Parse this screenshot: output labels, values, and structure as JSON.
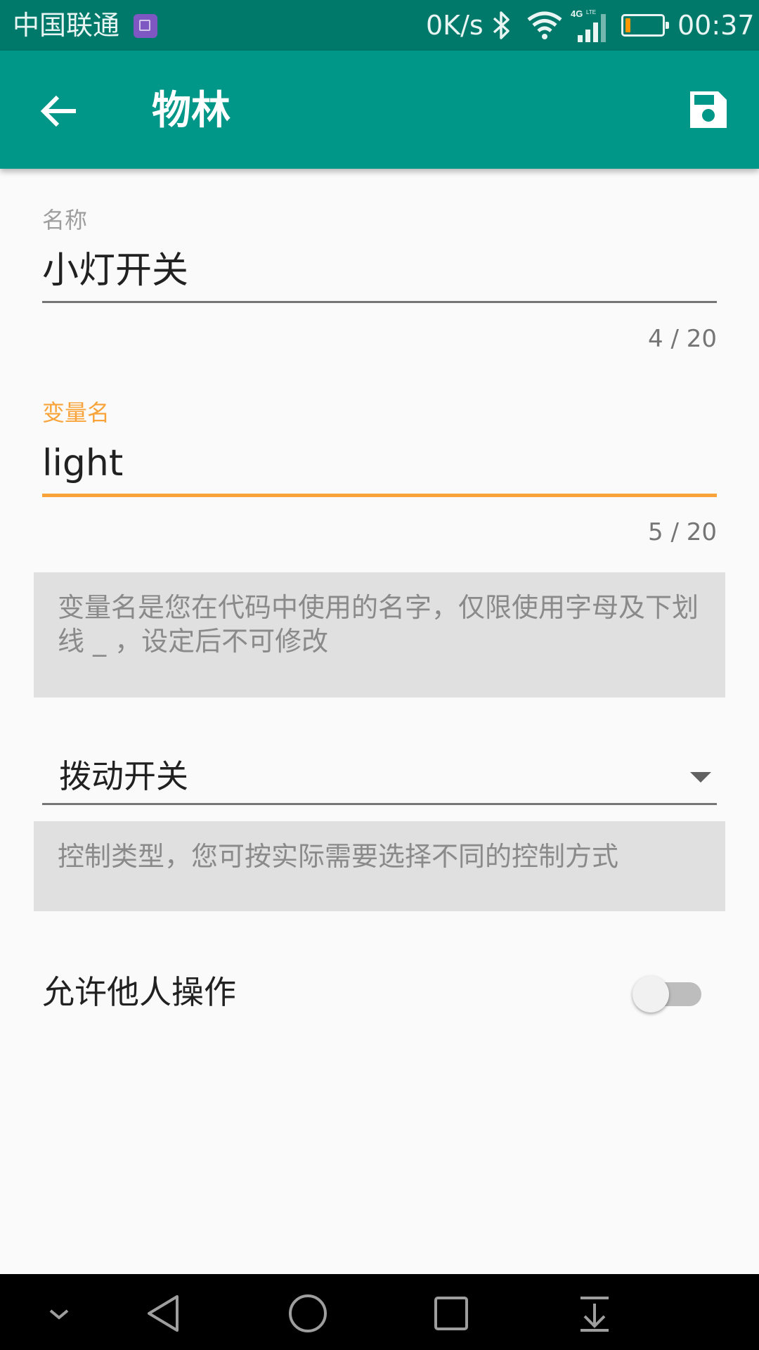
{
  "status_bar": {
    "carrier": "中国联通",
    "speed": "0K/s",
    "network_type": "4G LTE",
    "time": "00:37",
    "icons": [
      "gallery-notification-icon",
      "bluetooth-icon",
      "wifi-icon",
      "signal-icon",
      "battery-icon"
    ],
    "battery_level": 0.1
  },
  "app_bar": {
    "title": "物林",
    "back_icon": "arrow-back-icon",
    "save_icon": "save-icon"
  },
  "form": {
    "name_field": {
      "label": "名称",
      "value": "小灯开关",
      "counter": "4 / 20"
    },
    "variable_field": {
      "label": "变量名",
      "value": "light",
      "counter": "5 / 20",
      "focused": true
    },
    "variable_hint": "变量名是您在代码中使用的名字，仅限使用字母及下划线 _ ，设定后不可修改",
    "control_type": {
      "selected": "拨动开关"
    },
    "control_hint": "控制类型，您可按实际需要选择不同的控制方式",
    "allow_others": {
      "label": "允许他人操作",
      "enabled": false
    }
  },
  "colors": {
    "primary": "#009688",
    "primary_dark": "#00796b",
    "accent": "#f8a43a",
    "hint_bg": "#e0e0e0"
  },
  "nav_bar": {
    "icons": [
      "collapse-chevron-icon",
      "back-triangle-icon",
      "home-circle-icon",
      "recents-square-icon",
      "notification-pulldown-icon"
    ]
  }
}
